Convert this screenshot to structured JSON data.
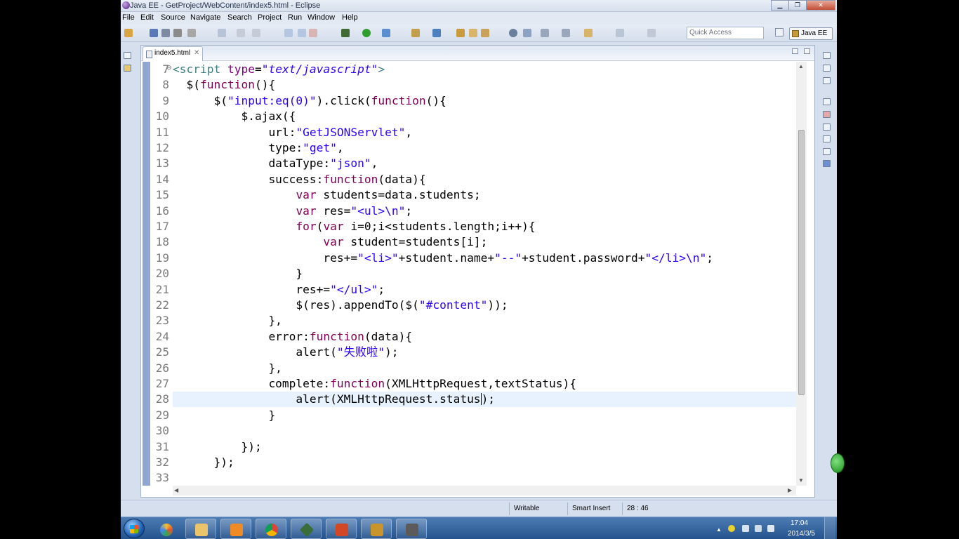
{
  "window": {
    "title": "Java EE - GetProject/WebContent/index5.html - Eclipse",
    "minimize": "▁",
    "maximize": "❐",
    "close": "✕"
  },
  "menu": [
    "File",
    "Edit",
    "Source",
    "Navigate",
    "Search",
    "Project",
    "Run",
    "Window",
    "Help"
  ],
  "toolbar": {
    "quick_access_placeholder": "Quick Access",
    "perspective": "Java EE"
  },
  "editor": {
    "tab_label": "index5.html",
    "tab_close": "✕",
    "line_numbers": [
      "7",
      "8",
      "9",
      "10",
      "11",
      "12",
      "13",
      "14",
      "15",
      "16",
      "17",
      "18",
      "19",
      "20",
      "21",
      "22",
      "23",
      "24",
      "25",
      "26",
      "27",
      "28",
      "29",
      "30",
      "31",
      "32",
      "33"
    ],
    "lines": [
      [
        {
          "t": "<script ",
          "c": "tag"
        },
        {
          "t": "type",
          "c": "attr"
        },
        {
          "t": "=",
          "c": ""
        },
        {
          "t": "\"text/javascript\"",
          "c": "val"
        },
        {
          "t": ">",
          "c": "tag"
        }
      ],
      [
        {
          "t": "  $(",
          "c": ""
        },
        {
          "t": "function",
          "c": "kw"
        },
        {
          "t": "(){",
          "c": ""
        }
      ],
      [
        {
          "t": "      $(",
          "c": ""
        },
        {
          "t": "\"input:eq(0)\"",
          "c": "str"
        },
        {
          "t": ").click(",
          "c": ""
        },
        {
          "t": "function",
          "c": "kw"
        },
        {
          "t": "(){",
          "c": ""
        }
      ],
      [
        {
          "t": "          $.ajax({",
          "c": ""
        }
      ],
      [
        {
          "t": "              url:",
          "c": ""
        },
        {
          "t": "\"GetJSONServlet\"",
          "c": "str"
        },
        {
          "t": ",",
          "c": ""
        }
      ],
      [
        {
          "t": "              type:",
          "c": ""
        },
        {
          "t": "\"get\"",
          "c": "str"
        },
        {
          "t": ",",
          "c": ""
        }
      ],
      [
        {
          "t": "              dataType:",
          "c": ""
        },
        {
          "t": "\"json\"",
          "c": "str"
        },
        {
          "t": ",",
          "c": ""
        }
      ],
      [
        {
          "t": "              success:",
          "c": ""
        },
        {
          "t": "function",
          "c": "kw"
        },
        {
          "t": "(data){",
          "c": ""
        }
      ],
      [
        {
          "t": "                  ",
          "c": ""
        },
        {
          "t": "var",
          "c": "kw"
        },
        {
          "t": " students=data.students;",
          "c": ""
        }
      ],
      [
        {
          "t": "                  ",
          "c": ""
        },
        {
          "t": "var",
          "c": "kw"
        },
        {
          "t": " res=",
          "c": ""
        },
        {
          "t": "\"<ul>\\n\"",
          "c": "str"
        },
        {
          "t": ";",
          "c": ""
        }
      ],
      [
        {
          "t": "                  ",
          "c": ""
        },
        {
          "t": "for",
          "c": "kw"
        },
        {
          "t": "(",
          "c": ""
        },
        {
          "t": "var",
          "c": "kw"
        },
        {
          "t": " i=0;i<students.length;i++){",
          "c": ""
        }
      ],
      [
        {
          "t": "                      ",
          "c": ""
        },
        {
          "t": "var",
          "c": "kw"
        },
        {
          "t": " student=students[i];",
          "c": ""
        }
      ],
      [
        {
          "t": "                      res+=",
          "c": ""
        },
        {
          "t": "\"<li>\"",
          "c": "str"
        },
        {
          "t": "+student.name+",
          "c": ""
        },
        {
          "t": "\"--\"",
          "c": "str"
        },
        {
          "t": "+student.password+",
          "c": ""
        },
        {
          "t": "\"</li>\\n\"",
          "c": "str"
        },
        {
          "t": ";",
          "c": ""
        }
      ],
      [
        {
          "t": "                  }",
          "c": ""
        }
      ],
      [
        {
          "t": "                  res+=",
          "c": ""
        },
        {
          "t": "\"</ul>\"",
          "c": "str"
        },
        {
          "t": ";",
          "c": ""
        }
      ],
      [
        {
          "t": "                  $(res).appendTo($(",
          "c": ""
        },
        {
          "t": "\"#content\"",
          "c": "str"
        },
        {
          "t": "));",
          "c": ""
        }
      ],
      [
        {
          "t": "              },",
          "c": ""
        }
      ],
      [
        {
          "t": "              error:",
          "c": ""
        },
        {
          "t": "function",
          "c": "kw"
        },
        {
          "t": "(data){",
          "c": ""
        }
      ],
      [
        {
          "t": "                  alert(",
          "c": ""
        },
        {
          "t": "\"失败啦\"",
          "c": "str"
        },
        {
          "t": ");",
          "c": ""
        }
      ],
      [
        {
          "t": "              },",
          "c": ""
        }
      ],
      [
        {
          "t": "              complete:",
          "c": ""
        },
        {
          "t": "function",
          "c": "kw"
        },
        {
          "t": "(XMLHttpRequest,textStatus){",
          "c": ""
        }
      ],
      [
        {
          "t": "                  alert(XMLHttpRequest.status",
          "c": ""
        },
        {
          "t": "|",
          "c": "caret"
        },
        {
          "t": ");",
          "c": ""
        }
      ],
      [
        {
          "t": "              }",
          "c": ""
        }
      ],
      [
        {
          "t": "",
          "c": ""
        }
      ],
      [
        {
          "t": "          });",
          "c": ""
        }
      ],
      [
        {
          "t": "      });",
          "c": ""
        }
      ],
      [
        {
          "t": "",
          "c": ""
        }
      ]
    ],
    "current_line": "28"
  },
  "status": {
    "writable": "Writable",
    "insert_mode": "Smart Insert",
    "position": "28 : 46"
  },
  "taskbar": {
    "clock_time": "17:04",
    "clock_date": "2014/3/5"
  },
  "colors": {
    "keyword": "#7f0055",
    "string": "#2a00ff",
    "tag": "#3f7f7f",
    "attribute": "#7f007f",
    "current_line": "#e8f2fe"
  }
}
